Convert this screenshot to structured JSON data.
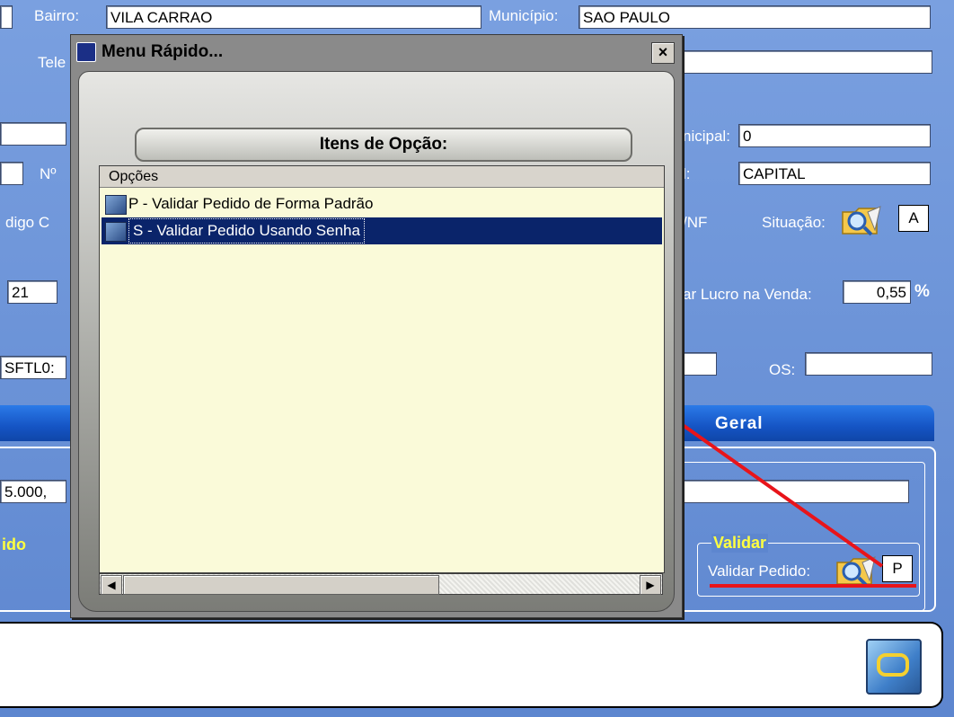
{
  "form": {
    "bairro_label": "Bairro:",
    "bairro_value": "VILA CARRAO",
    "municipio_label": "Município:",
    "municipio_value": "SAO PAULO",
    "telefone_label": "Tele",
    "insc_municipal_label": "nicipal:",
    "insc_municipal_value": "0",
    "numero_label": "Nº",
    "regiao_label": "l:",
    "regiao_value": "CAPITAL",
    "codigo_label": "digo C",
    "nf_label": "/NF",
    "situacao_label": "Situação:",
    "situacao_value": "A",
    "field_21": "21",
    "lucro_label": "ar Lucro na Venda:",
    "lucro_value": "0,55",
    "lucro_unit": "%",
    "code_value": "SFTL0:",
    "os_label": "OS:",
    "valor_value": "5.000,",
    "group_left_label": "ido",
    "validar_group_label": "Validar",
    "validar_pedido_label": "Validar Pedido:",
    "validar_pedido_value": "P"
  },
  "tabs": {
    "geral_label": "Geral"
  },
  "dialog": {
    "title": "Menu Rápido...",
    "close_glyph": "×",
    "header_label": "Itens de Opção:",
    "list_header": "Opções",
    "items": [
      {
        "label": "P - Validar Pedido de Forma Padrão",
        "selected": false
      },
      {
        "label": "S - Validar Pedido Usando Senha",
        "selected": true
      }
    ],
    "scroll_left_glyph": "◀",
    "scroll_right_glyph": "▶"
  },
  "annotation": {
    "color": "#e8141a"
  }
}
